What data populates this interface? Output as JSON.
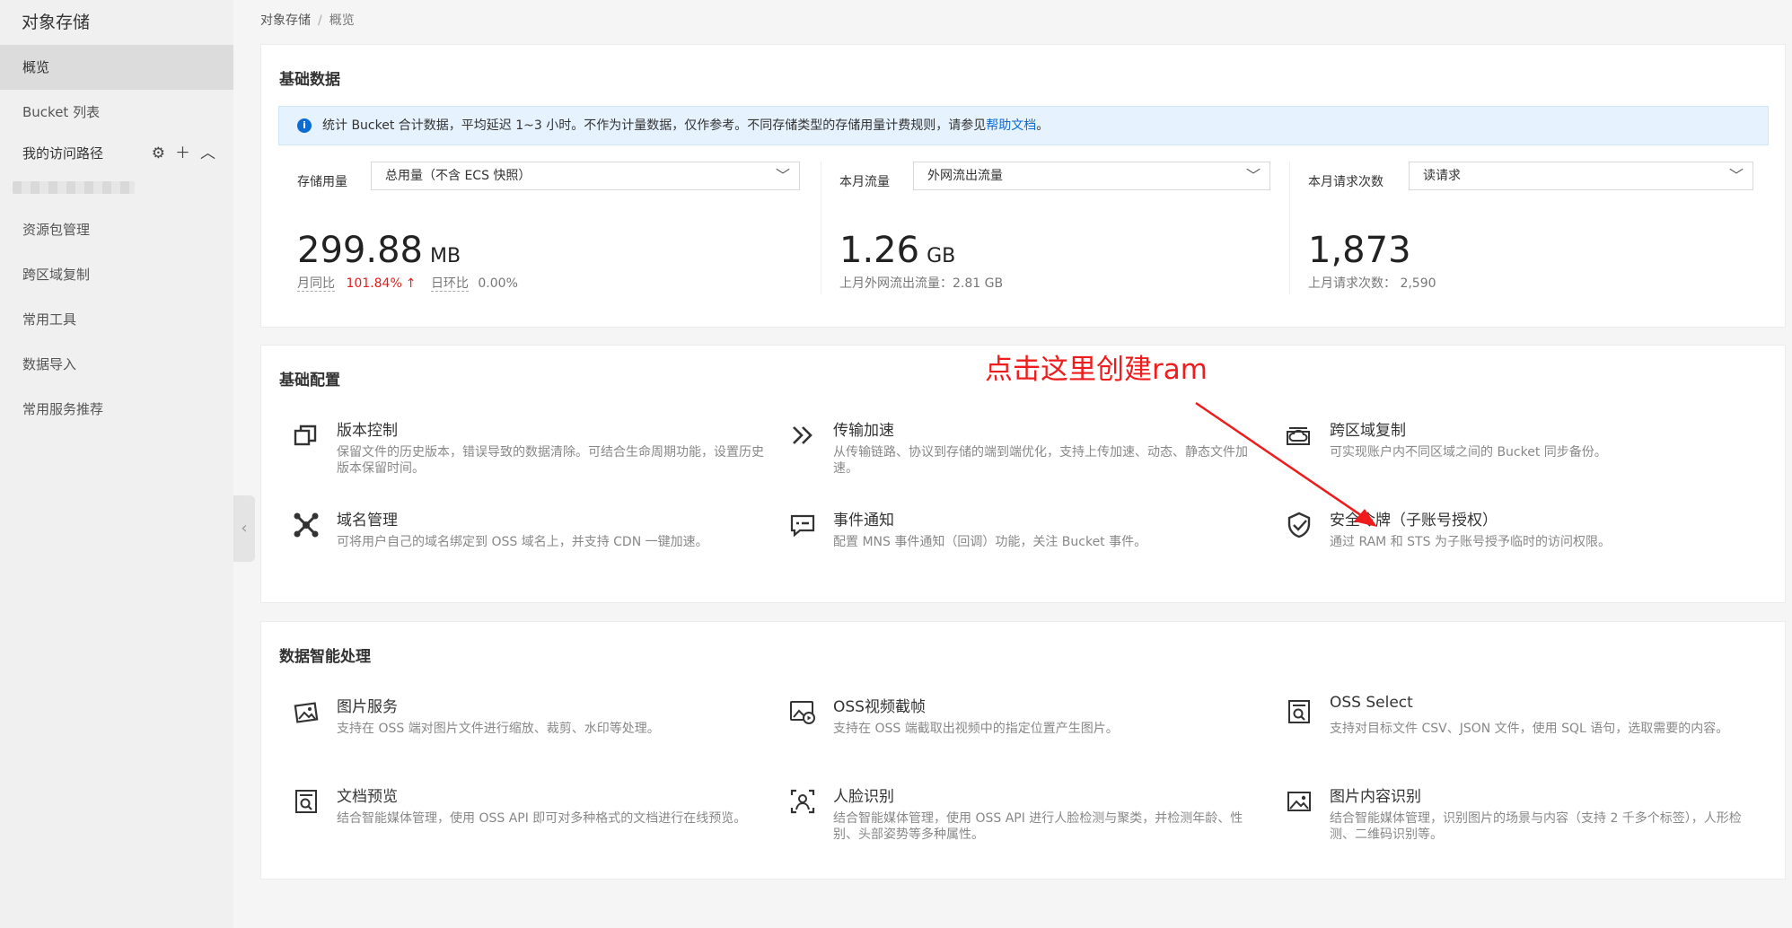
{
  "sidebar": {
    "title": "对象存储",
    "items": [
      {
        "label": "概览"
      },
      {
        "label": "Bucket 列表"
      },
      {
        "label": "资源包管理"
      },
      {
        "label": "跨区域复制"
      },
      {
        "label": "常用工具"
      },
      {
        "label": "数据导入"
      },
      {
        "label": "常用服务推荐"
      }
    ],
    "group": {
      "label": "我的访问路径",
      "icons": [
        "gear-icon",
        "plus-icon",
        "chevron-up-icon"
      ]
    }
  },
  "breadcrumb": {
    "root": "对象存储",
    "separator": "/",
    "current": "概览"
  },
  "basic_data": {
    "title": "基础数据",
    "info_text": "统计 Bucket 合计数据，平均延迟 1~3 小时。不作为计量数据，仅作参考。不同存储类型的存储用量计费规则，请参见",
    "info_link": "帮助文档",
    "info_suffix": "。",
    "stats": [
      {
        "label": "存储用量",
        "select": "总用量（不含 ECS 快照）",
        "value": "299.88",
        "unit": "MB",
        "mom_label": "月同比",
        "mom_value": "101.84%",
        "dod_label": "日环比",
        "dod_value": "0.00%"
      },
      {
        "label": "本月流量",
        "select": "外网流出流量",
        "value": "1.26",
        "unit": "GB",
        "sub": "上月外网流出流量：2.81 GB"
      },
      {
        "label": "本月请求次数",
        "select": "读请求",
        "value": "1,873",
        "unit": "",
        "sub": "上月请求次数：  2,590"
      }
    ]
  },
  "basic_config": {
    "title": "基础配置",
    "features": [
      {
        "icon": "version-copy-icon",
        "title": "版本控制",
        "desc": "保留文件的历史版本，错误导致的数据清除。可结合生命周期功能，设置历史版本保留时间。"
      },
      {
        "icon": "double-chevron-right-icon",
        "title": "传输加速",
        "desc": "从传输链路、协议到存储的端到端优化，支持上传加速、动态、静态文件加速。"
      },
      {
        "icon": "cloud-replication-icon",
        "title": "跨区域复制",
        "desc": "可实现账户内不同区域之间的 Bucket 同步备份。"
      },
      {
        "icon": "domain-network-icon",
        "title": "域名管理",
        "desc": "可将用户自己的域名绑定到 OSS 域名上，并支持 CDN 一键加速。"
      },
      {
        "icon": "event-message-icon",
        "title": "事件通知",
        "desc": "配置 MNS 事件通知（回调）功能，关注 Bucket 事件。"
      },
      {
        "icon": "shield-check-icon",
        "title": "安全令牌（子账号授权）",
        "desc": "通过 RAM 和 STS 为子账号授予临时的访问权限。"
      }
    ]
  },
  "annotation": {
    "text": "点击这里创建ram",
    "color": "#ee1c1c"
  },
  "data_processing": {
    "title": "数据智能处理",
    "features": [
      {
        "icon": "image-service-icon",
        "title": "图片服务",
        "desc": "支持在 OSS 端对图片文件进行缩放、裁剪、水印等处理。"
      },
      {
        "icon": "video-snapshot-icon",
        "title": "OSS视频截帧",
        "desc": "支持在 OSS 端截取出视频中的指定位置产生图片。"
      },
      {
        "icon": "select-search-icon",
        "title": "OSS Select",
        "desc": "支持对目标文件 CSV、JSON 文件，使用 SQL 语句，选取需要的内容。"
      },
      {
        "icon": "document-preview-icon",
        "title": "文档预览",
        "desc": "结合智能媒体管理，使用 OSS API 即可对多种格式的文档进行在线预览。"
      },
      {
        "icon": "face-recognition-icon",
        "title": "人脸识别",
        "desc": "结合智能媒体管理，使用 OSS API 进行人脸检测与聚类，并检测年龄、性别、头部姿势等多种属性。"
      },
      {
        "icon": "image-content-icon",
        "title": "图片内容识别",
        "desc": "结合智能媒体管理，识别图片的场景与内容（支持 2 千多个标签），人形检测、二维码识别等。"
      }
    ]
  },
  "colors": {
    "accent": "#0d6bd4",
    "info_bg": "#e6f2fd",
    "up": "#e02020",
    "annotation": "#ee1c1c"
  }
}
